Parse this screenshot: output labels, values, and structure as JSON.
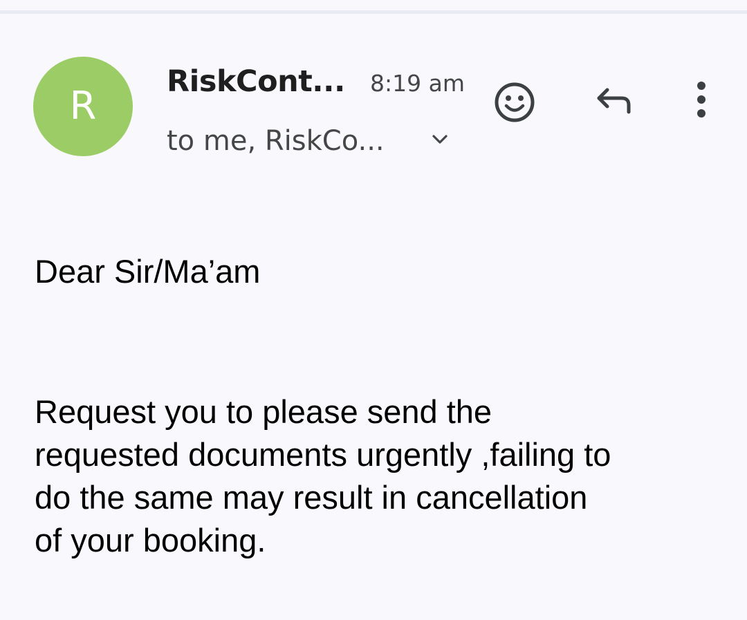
{
  "message": {
    "sender_initial": "R",
    "sender_name": "RiskCont...",
    "time": "8:19 am",
    "recipients": "to me, RiskCo...",
    "avatar_color": "#9ccc65"
  },
  "actions": {
    "details_toggle_icon": "chevron-down-icon",
    "emoji_icon": "emoji-reaction-icon",
    "reply_icon": "reply-icon",
    "more_icon": "more-vert-icon"
  },
  "body": {
    "greeting": "Dear Sir/Ma’am",
    "paragraph_lines": [
      "Request you to please send the",
      "requested documents urgently ,failing to",
      "do the same may result in cancellation",
      "of your booking."
    ]
  }
}
